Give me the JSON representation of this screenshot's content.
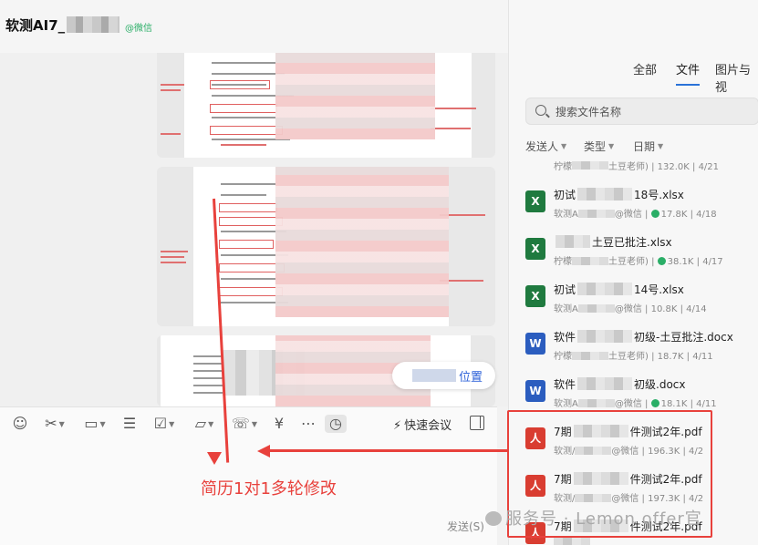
{
  "header": {
    "title": "软测AI7_",
    "badge": "@微信"
  },
  "chat": {
    "locate_button": "位置"
  },
  "toolbar": {
    "quick_meeting": "快速会议"
  },
  "compose": {
    "annotation": "简历1对1多轮修改",
    "send_label": "发送(S)"
  },
  "sidebar": {
    "tabs": [
      "全部",
      "文件",
      "图片与视"
    ],
    "active_tab": "文件",
    "search_placeholder": "搜索文件名称",
    "filters": [
      "发送人",
      "类型",
      "日期"
    ]
  },
  "files": [
    {
      "type": "xlsx",
      "icon": "X",
      "name_start": "初试",
      "name_end": "18号.xlsx",
      "meta_start": "软测A",
      "meta_mid": "@微信",
      "size": "17.8K",
      "date": "4/18",
      "downloaded": true
    },
    {
      "type": "xlsx",
      "icon": "X",
      "name_start": "",
      "name_end": "土豆已批注.xlsx",
      "meta_start": "柠檬",
      "meta_mid": "土豆老师)",
      "size": "38.1K",
      "date": "4/17",
      "downloaded": true
    },
    {
      "type": "xlsx",
      "icon": "X",
      "name_start": "初试",
      "name_end": "14号.xlsx",
      "meta_start": "软测A",
      "meta_mid": "@微信",
      "size": "10.8K",
      "date": "4/14",
      "downloaded": false
    },
    {
      "type": "docx",
      "icon": "W",
      "name_start": "软件",
      "name_end": "初级-土豆批注.docx",
      "meta_start": "柠檬",
      "meta_mid": "土豆老师)",
      "size": "18.7K",
      "date": "4/11",
      "downloaded": false
    },
    {
      "type": "docx",
      "icon": "W",
      "name_start": "软件",
      "name_end": "初级.docx",
      "meta_start": "软测A",
      "meta_mid": "@微信",
      "size": "18.1K",
      "date": "4/11",
      "downloaded": true
    },
    {
      "type": "pdf",
      "icon": "人",
      "name_start": "7期",
      "name_end": "件测试2年.pdf",
      "meta_start": "软测/",
      "meta_mid": "@微信",
      "size": "196.3K",
      "date": "4/2",
      "downloaded": false
    },
    {
      "type": "pdf",
      "icon": "人",
      "name_start": "7期",
      "name_end": "件测试2年.pdf",
      "meta_start": "软测/",
      "meta_mid": "@微信",
      "size": "197.3K",
      "date": "4/2",
      "downloaded": false
    },
    {
      "type": "pdf",
      "icon": "人",
      "name_start": "7期",
      "name_end": "件测试2年.pdf",
      "meta_start": "",
      "meta_mid": "",
      "size": "",
      "date": "",
      "downloaded": false
    }
  ],
  "top_partial_row": {
    "meta_start": "柠檬",
    "meta_mid": "土豆老师)",
    "size": "132.0K",
    "date": "4/21"
  },
  "watermark": "服务号 · Lemon offer官",
  "colors": {
    "annotation_red": "#e8413c",
    "accent_blue": "#2a72d8",
    "excel_green": "#1f7a3f",
    "word_blue": "#2b5dbf",
    "pdf_red": "#d93d31"
  }
}
